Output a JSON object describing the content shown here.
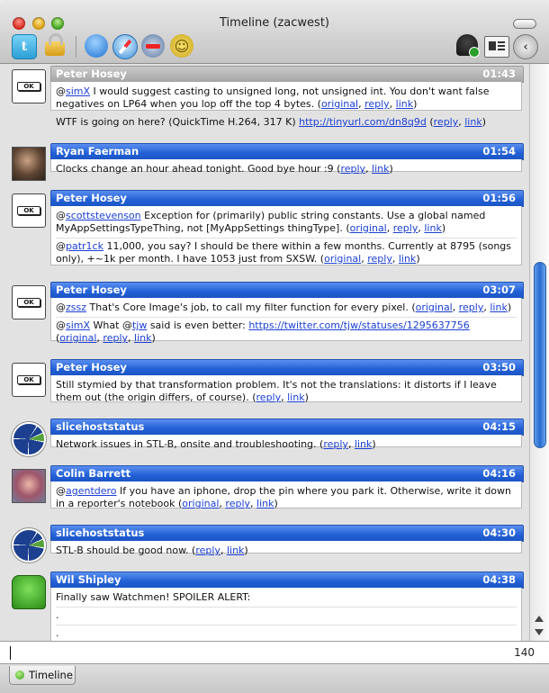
{
  "window": {
    "title": "Timeline (zacwest)"
  },
  "toolbar": {
    "twitter_glyph": "t",
    "smiley_glyph": "☺",
    "back_glyph": "‹"
  },
  "link_words": {
    "original": "original",
    "reply": "reply",
    "link": "link"
  },
  "posts": [
    {
      "author": "Peter Hosey",
      "time": "01:43",
      "avatar": "ok-button",
      "avatar_text": "OK",
      "header": "gray",
      "messages": [
        [
          {
            "t": "@"
          },
          {
            "l": "simX"
          },
          {
            "t": " I would suggest casting to unsigned long, not unsigned int. You don't want false negatives on LP64 when you lop off the top 4 bytes.  ("
          },
          {
            "l": "original"
          },
          {
            "t": ", "
          },
          {
            "l": "reply"
          },
          {
            "t": ", "
          },
          {
            "l": "link"
          },
          {
            "t": ")"
          }
        ],
        [
          {
            "t": "WTF is going on here? (QuickTime H.264, 317 K) "
          },
          {
            "l": "http://tinyurl.com/dn8q9d"
          },
          {
            "t": "  ("
          },
          {
            "l": "reply"
          },
          {
            "t": ", "
          },
          {
            "l": "link"
          },
          {
            "t": ")"
          }
        ]
      ]
    },
    {
      "author": "Ryan Faerman",
      "time": "01:54",
      "avatar": "photo",
      "header": "blue",
      "messages": [
        [
          {
            "t": "Clocks change an hour ahead tonight. Good bye hour :9  ("
          },
          {
            "l": "reply"
          },
          {
            "t": ", "
          },
          {
            "l": "link"
          },
          {
            "t": ")"
          }
        ]
      ]
    },
    {
      "author": "Peter Hosey",
      "time": "01:56",
      "avatar": "ok-button",
      "avatar_text": "OK",
      "header": "blue",
      "messages": [
        [
          {
            "t": "@"
          },
          {
            "l": "scottstevenson"
          },
          {
            "t": " Exception for (primarily) public string constants. Use a global named MyAppSettingsTypeThing, not [MyAppSettings thingType].  ("
          },
          {
            "l": "original"
          },
          {
            "t": ", "
          },
          {
            "l": "reply"
          },
          {
            "t": ", "
          },
          {
            "l": "link"
          },
          {
            "t": ")"
          }
        ],
        [
          {
            "t": "@"
          },
          {
            "l": "patr1ck"
          },
          {
            "t": " 11,000, you say? I should be there within a few months. Currently at 8795 (songs only), +~1k per month. I have 1053 just from SXSW.  ("
          },
          {
            "l": "original"
          },
          {
            "t": ", "
          },
          {
            "l": "reply"
          },
          {
            "t": ", "
          },
          {
            "l": "link"
          },
          {
            "t": ")"
          }
        ]
      ]
    },
    {
      "author": "Peter Hosey",
      "time": "03:07",
      "avatar": "ok-button",
      "avatar_text": "OK",
      "header": "blue",
      "messages": [
        [
          {
            "t": "@"
          },
          {
            "l": "zssz"
          },
          {
            "t": " That's Core Image's job, to call my filter function for every pixel.  ("
          },
          {
            "l": "original"
          },
          {
            "t": ", "
          },
          {
            "l": "reply"
          },
          {
            "t": ", "
          },
          {
            "l": "link"
          },
          {
            "t": ")"
          }
        ],
        [
          {
            "t": "@"
          },
          {
            "l": "simX"
          },
          {
            "t": " What @"
          },
          {
            "l": "tjw"
          },
          {
            "t": " said is even better: "
          },
          {
            "l": "https://twitter.com/tjw/statuses/1295637756"
          },
          {
            "t": " ("
          },
          {
            "l": "original"
          },
          {
            "t": ", "
          },
          {
            "l": "reply"
          },
          {
            "t": ", "
          },
          {
            "l": "link"
          },
          {
            "t": ")"
          }
        ]
      ]
    },
    {
      "author": "Peter Hosey",
      "time": "03:50",
      "avatar": "ok-button",
      "avatar_text": "OK",
      "header": "blue",
      "messages": [
        [
          {
            "t": "Still stymied by that transformation problem. It's not the translations: it distorts if I leave them out (the origin differs, of course).  ("
          },
          {
            "l": "reply"
          },
          {
            "t": ", "
          },
          {
            "l": "link"
          },
          {
            "t": ")"
          }
        ]
      ]
    },
    {
      "author": "slicehoststatus",
      "time": "04:15",
      "avatar": "wheel",
      "header": "blue",
      "messages": [
        [
          {
            "t": "Network issues in STL-B, onsite and troubleshooting.  ("
          },
          {
            "l": "reply"
          },
          {
            "t": ", "
          },
          {
            "l": "link"
          },
          {
            "t": ")"
          }
        ]
      ]
    },
    {
      "author": "Colin Barrett",
      "time": "04:16",
      "avatar": "photo2",
      "header": "blue",
      "messages": [
        [
          {
            "t": "@"
          },
          {
            "l": "agentdero"
          },
          {
            "t": " If you have an iphone, drop the pin where you park it. Otherwise, write it down in a reporter's notebook  ("
          },
          {
            "l": "original"
          },
          {
            "t": ", "
          },
          {
            "l": "reply"
          },
          {
            "t": ", "
          },
          {
            "l": "link"
          },
          {
            "t": ")"
          }
        ]
      ]
    },
    {
      "author": "slicehoststatus",
      "time": "04:30",
      "avatar": "wheel",
      "header": "blue",
      "messages": [
        [
          {
            "t": "STL-B should be good now.  ("
          },
          {
            "l": "reply"
          },
          {
            "t": ", "
          },
          {
            "l": "link"
          },
          {
            "t": ")"
          }
        ]
      ]
    },
    {
      "author": "Wil Shipley",
      "time": "04:38",
      "avatar": "robot",
      "header": "blue",
      "messages": [
        [
          {
            "t": "Finally saw Watchmen! SPOILER ALERT:"
          }
        ],
        [
          {
            "t": "."
          }
        ],
        [
          {
            "t": "."
          }
        ],
        [
          {
            "t": "."
          }
        ]
      ]
    }
  ],
  "composer": {
    "value": "",
    "remaining": "140"
  },
  "tabs": [
    {
      "label": "Timeline"
    }
  ]
}
